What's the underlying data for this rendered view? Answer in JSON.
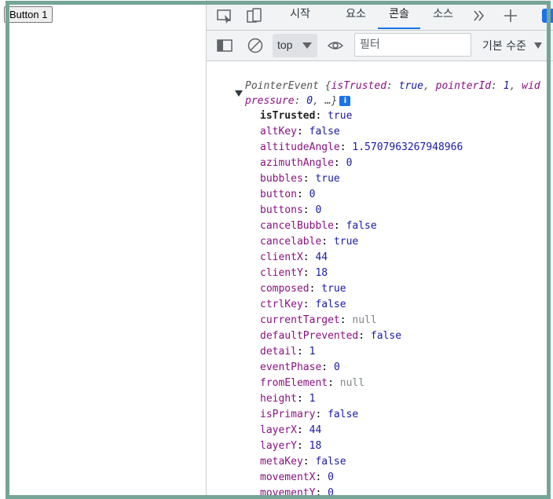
{
  "page": {
    "button_label": "Button 1"
  },
  "devtools": {
    "tabs": [
      {
        "label": "시작"
      },
      {
        "label": "요소"
      },
      {
        "label": "콘솔"
      },
      {
        "label": "소스"
      }
    ],
    "active_tab": "콘솔",
    "toolbar": {
      "context": "top",
      "filter_placeholder": "필터",
      "levels_label": "기본 수준"
    }
  },
  "console": {
    "summary_line1_prefix": "PointerEvent {",
    "summary_line1_parts": [
      {
        "key": "isTrusted",
        "value": "true"
      },
      {
        "key": "pointerId",
        "value": "1"
      },
      {
        "key": "wid",
        "value": ""
      }
    ],
    "summary_line2_key": "pressure",
    "summary_line2_value": "0",
    "summary_line2_suffix": ", …}",
    "info_badge": "i",
    "properties": [
      {
        "key": "isTrusted",
        "value": "true",
        "own": true
      },
      {
        "key": "altKey",
        "value": "false"
      },
      {
        "key": "altitudeAngle",
        "value": "1.5707963267948966"
      },
      {
        "key": "azimuthAngle",
        "value": "0"
      },
      {
        "key": "bubbles",
        "value": "true"
      },
      {
        "key": "button",
        "value": "0"
      },
      {
        "key": "buttons",
        "value": "0"
      },
      {
        "key": "cancelBubble",
        "value": "false"
      },
      {
        "key": "cancelable",
        "value": "true"
      },
      {
        "key": "clientX",
        "value": "44"
      },
      {
        "key": "clientY",
        "value": "18"
      },
      {
        "key": "composed",
        "value": "true"
      },
      {
        "key": "ctrlKey",
        "value": "false"
      },
      {
        "key": "currentTarget",
        "value": "null"
      },
      {
        "key": "defaultPrevented",
        "value": "false"
      },
      {
        "key": "detail",
        "value": "1"
      },
      {
        "key": "eventPhase",
        "value": "0"
      },
      {
        "key": "fromElement",
        "value": "null"
      },
      {
        "key": "height",
        "value": "1"
      },
      {
        "key": "isPrimary",
        "value": "false"
      },
      {
        "key": "layerX",
        "value": "44"
      },
      {
        "key": "layerY",
        "value": "18"
      },
      {
        "key": "metaKey",
        "value": "false"
      },
      {
        "key": "movementX",
        "value": "0"
      },
      {
        "key": "movementY",
        "value": "0"
      }
    ]
  },
  "colors": {
    "frame": "#75a597",
    "accent": "#1a73e8",
    "key": "#881280",
    "value": "#1a1aa6"
  }
}
